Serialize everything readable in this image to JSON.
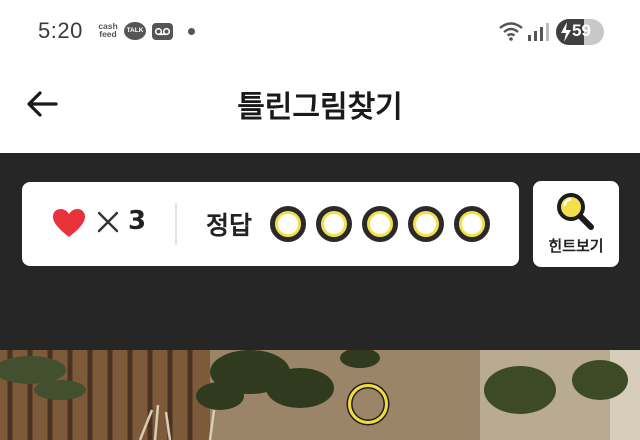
{
  "status_bar": {
    "time": "5:20",
    "cash_logo_line1": "cash",
    "cash_logo_line2": "feed",
    "talk_label": "TALK",
    "battery_level": "59",
    "battery_fill_percent": 59,
    "icons": [
      "cashfeed-logo",
      "kakaotalk-icon",
      "voicemail-icon",
      "notification-dot-icon",
      "wifi-icon",
      "signal-icon",
      "battery-charging-icon"
    ]
  },
  "header": {
    "title": "틀린그림찾기",
    "back_icon": "arrow-left-icon"
  },
  "game": {
    "lives_icon": "heart-icon",
    "lives_times": "×",
    "lives_count": "3",
    "answer_label": "정답",
    "answer_slots": [
      {
        "found": false
      },
      {
        "found": false
      },
      {
        "found": false
      },
      {
        "found": false
      },
      {
        "found": false
      }
    ],
    "hint_label": "힌트보기",
    "hint_icon": "magnifier-icon",
    "colors": {
      "accent_yellow": "#f3e04a",
      "heart_red": "#e8313b",
      "dark_bg": "#262626"
    }
  }
}
